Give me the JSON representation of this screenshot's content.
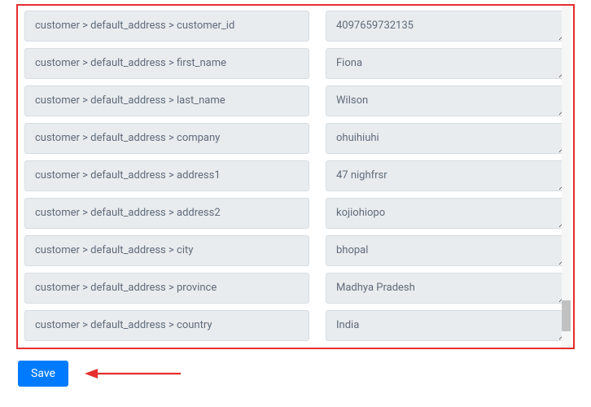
{
  "fields": [
    {
      "label": "customer > default_address > customer_id",
      "value": "4097659732135"
    },
    {
      "label": "customer > default_address > first_name",
      "value": "Fiona"
    },
    {
      "label": "customer > default_address > last_name",
      "value": "Wilson"
    },
    {
      "label": "customer > default_address > company",
      "value": "ohuihiuhi"
    },
    {
      "label": "customer > default_address > address1",
      "value": "47 nighfrsr"
    },
    {
      "label": "customer > default_address > address2",
      "value": "kojiohiopo"
    },
    {
      "label": "customer > default_address > city",
      "value": "bhopal"
    },
    {
      "label": "customer > default_address > province",
      "value": "Madhya Pradesh"
    },
    {
      "label": "customer > default_address > country",
      "value": "India"
    }
  ],
  "actions": {
    "save_label": "Save"
  },
  "annotation": {
    "highlight_color": "#e52e2e",
    "arrow_color": "#e52e2e"
  }
}
